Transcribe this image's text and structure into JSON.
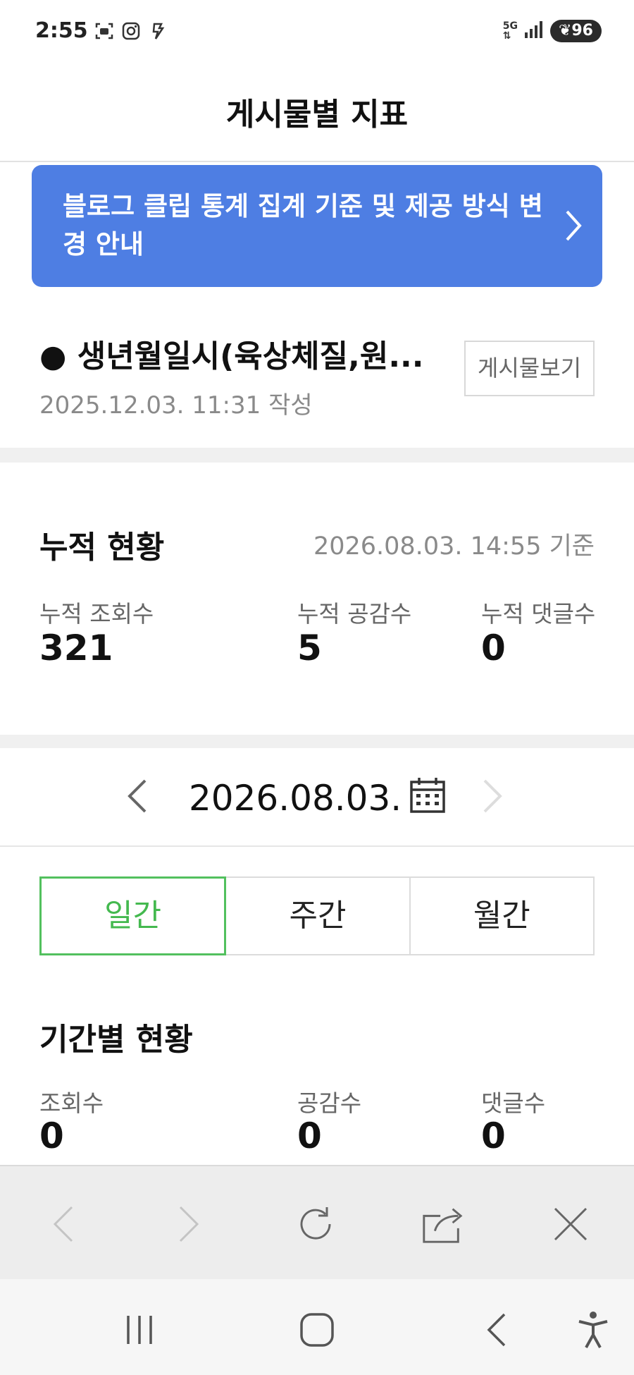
{
  "status_bar": {
    "time": "2:55",
    "network": "5G",
    "battery": "96"
  },
  "header": {
    "title": "게시물별 지표"
  },
  "notice": {
    "text": "블로그 클립 통계 집계 기준 및 제공 방식 변경 안내"
  },
  "post": {
    "title": "● 생년월일시(육상체질,원...",
    "date": "2025.12.03. 11:31 작성",
    "view_button": "게시물보기"
  },
  "cumulative": {
    "heading": "누적 현황",
    "basis": "2026.08.03. 14:55 기준",
    "stats": [
      {
        "label": "누적 조회수",
        "value": "321"
      },
      {
        "label": "누적 공감수",
        "value": "5"
      },
      {
        "label": "누적 댓글수",
        "value": "0"
      }
    ]
  },
  "date_nav": {
    "date": "2026.08.03."
  },
  "period_tabs": [
    {
      "label": "일간",
      "active": true
    },
    {
      "label": "주간",
      "active": false
    },
    {
      "label": "월간",
      "active": false
    }
  ],
  "period": {
    "heading": "기간별 현황",
    "stats": [
      {
        "label": "조회수",
        "value": "0"
      },
      {
        "label": "공감수",
        "value": "0"
      },
      {
        "label": "댓글수",
        "value": "0"
      }
    ]
  },
  "colors": {
    "banner": "#4e7ee3",
    "active_tab": "#44b94f"
  }
}
